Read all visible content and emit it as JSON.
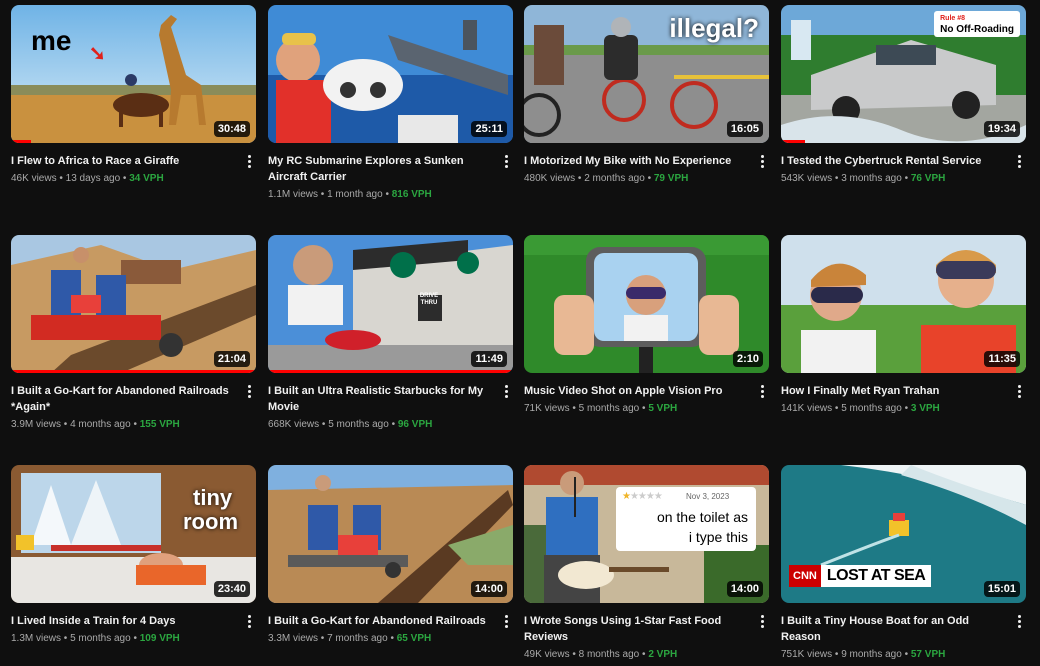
{
  "videos": [
    {
      "title": "I Flew to Africa to Race a Giraffe",
      "views": "46K views",
      "age": "13 days ago",
      "vph": "34 VPH",
      "duration": "30:48",
      "progress": 0.08,
      "overlay": "me"
    },
    {
      "title": "My RC Submarine Explores a Sunken Aircraft Carrier",
      "views": "1.1M views",
      "age": "1 month ago",
      "vph": "816 VPH",
      "duration": "25:11",
      "progress": 0
    },
    {
      "title": "I Motorized My Bike with No Experience",
      "views": "480K views",
      "age": "2 months ago",
      "vph": "79 VPH",
      "duration": "16:05",
      "progress": 0,
      "overlay": "illegal?"
    },
    {
      "title": "I Tested the Cybertruck Rental Service",
      "views": "543K views",
      "age": "3 months ago",
      "vph": "76 VPH",
      "duration": "19:34",
      "progress": 0.1,
      "badge_small": "Rule #8",
      "badge_big": "No Off-Roading"
    },
    {
      "title": "I Built a Go-Kart for Abandoned Railroads *Again*",
      "views": "3.9M views",
      "age": "4 months ago",
      "vph": "155 VPH",
      "duration": "21:04",
      "progress": 1
    },
    {
      "title": "I Built an Ultra Realistic Starbucks for My Movie",
      "views": "668K views",
      "age": "5 months ago",
      "vph": "96 VPH",
      "duration": "11:49",
      "progress": 1,
      "sign": "DRIVE THRU"
    },
    {
      "title": "Music Video Shot on Apple Vision Pro",
      "views": "71K views",
      "age": "5 months ago",
      "vph": "5 VPH",
      "duration": "2:10",
      "progress": 0
    },
    {
      "title": "How I Finally Met Ryan Trahan",
      "views": "141K views",
      "age": "5 months ago",
      "vph": "3 VPH",
      "duration": "11:35",
      "progress": 0
    },
    {
      "title": "I Lived Inside a Train for 4 Days",
      "views": "1.3M views",
      "age": "5 months ago",
      "vph": "109 VPH",
      "duration": "23:40",
      "progress": 0,
      "overlay1": "tiny",
      "overlay2": "room"
    },
    {
      "title": "I Built a Go-Kart for Abandoned Railroads",
      "views": "3.3M views",
      "age": "7 months ago",
      "vph": "65 VPH",
      "duration": "14:00",
      "progress": 0
    },
    {
      "title": "I Wrote Songs Using 1-Star Fast Food Reviews",
      "views": "49K views",
      "age": "8 months ago",
      "vph": "2 VPH",
      "duration": "14:00",
      "progress": 0,
      "review_date": "Nov 3, 2023",
      "review_line1": "on the toilet as",
      "review_line2": "i type this"
    },
    {
      "title": "I Built a Tiny House Boat for an Odd Reason",
      "views": "751K views",
      "age": "9 months ago",
      "vph": "57 VPH",
      "duration": "15:01",
      "progress": 0,
      "logo": "CNN",
      "headline": "LOST AT SEA"
    }
  ],
  "separator": " • ",
  "colors": {
    "background": "#0f0f0f",
    "vph": "#2ba640",
    "progress": "#ff0000",
    "secondary_text": "#aaaaaa"
  }
}
